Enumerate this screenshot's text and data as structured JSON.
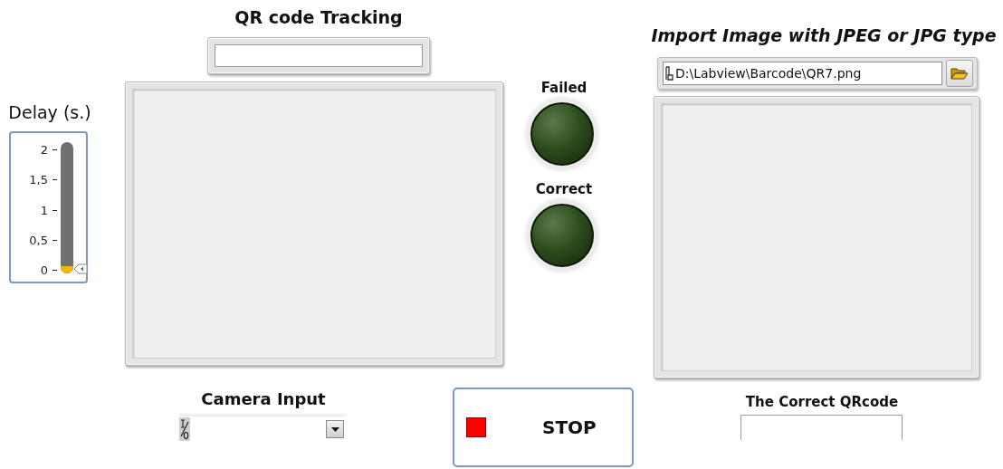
{
  "qr_tracking": {
    "label": "QR code Tracking"
  },
  "delay": {
    "label": "Delay (s.)",
    "ticks": [
      "2",
      "1,5",
      "1",
      "0,5",
      "0"
    ],
    "level": 0
  },
  "leds": [
    {
      "label": "Failed",
      "on": false
    },
    {
      "label": "Correct",
      "on": false
    }
  ],
  "import_image": {
    "label": "Import Image with JPEG or JPG type",
    "path": "D:\\Labview\\Barcode\\QR7.png"
  },
  "camera_input": {
    "label": "Camera Input"
  },
  "stop_button": {
    "label": "STOP",
    "pressed": false
  },
  "correct_qrcode": {
    "label": "The Correct QRcode"
  }
}
